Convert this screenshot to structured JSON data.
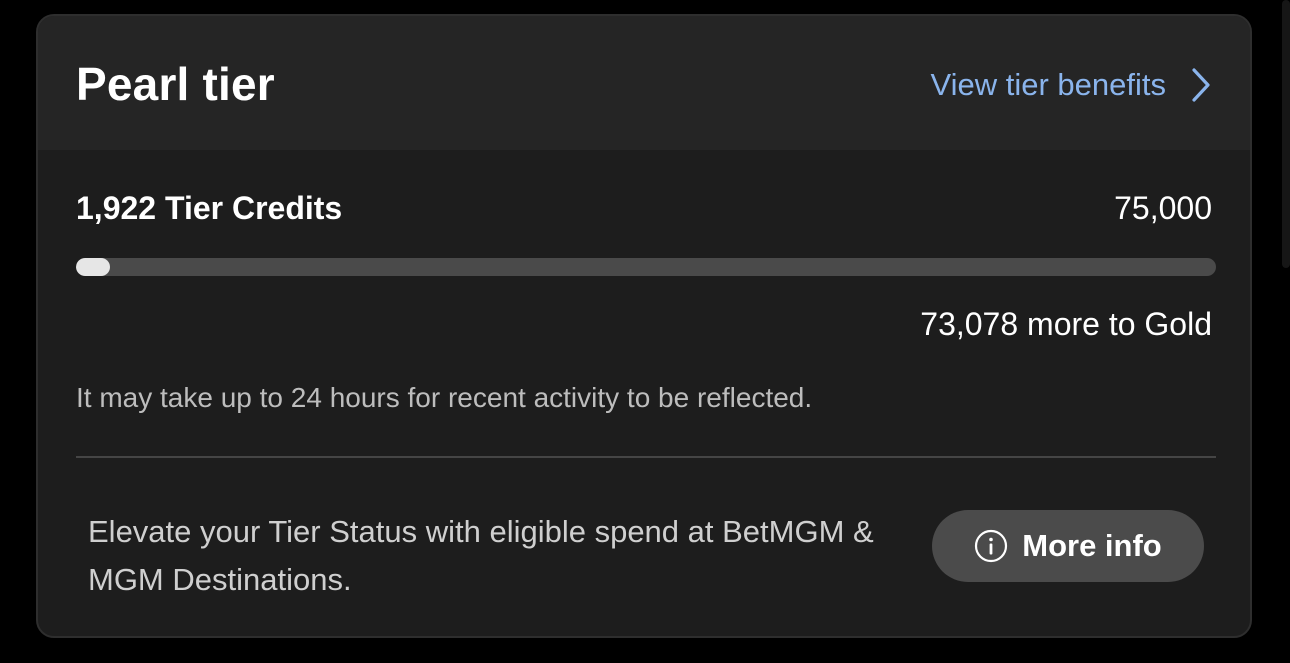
{
  "card": {
    "title": "Pearl tier",
    "benefits_link_label": "View tier benefits",
    "benefits_link_icon": "chevron-right-icon"
  },
  "progress": {
    "credits_label": "1,922 Tier Credits",
    "target_label": "75,000",
    "credits": 1922,
    "target": 75000,
    "remaining_label": "73,078 more to Gold",
    "fill_color": "#e6e6e6",
    "track_color": "#4a4a4a"
  },
  "note": "It may take up to 24 hours for recent activity to be reflected.",
  "footer": {
    "text": "Elevate your Tier Status with eligible spend at BetMGM & MGM Destinations.",
    "more_info_label": "More info",
    "more_info_icon": "info-circle-icon"
  },
  "colors": {
    "background": "#000000",
    "card": "#1d1d1d",
    "header": "#252525",
    "link": "#8ab4ec",
    "button": "#4b4b4b"
  }
}
